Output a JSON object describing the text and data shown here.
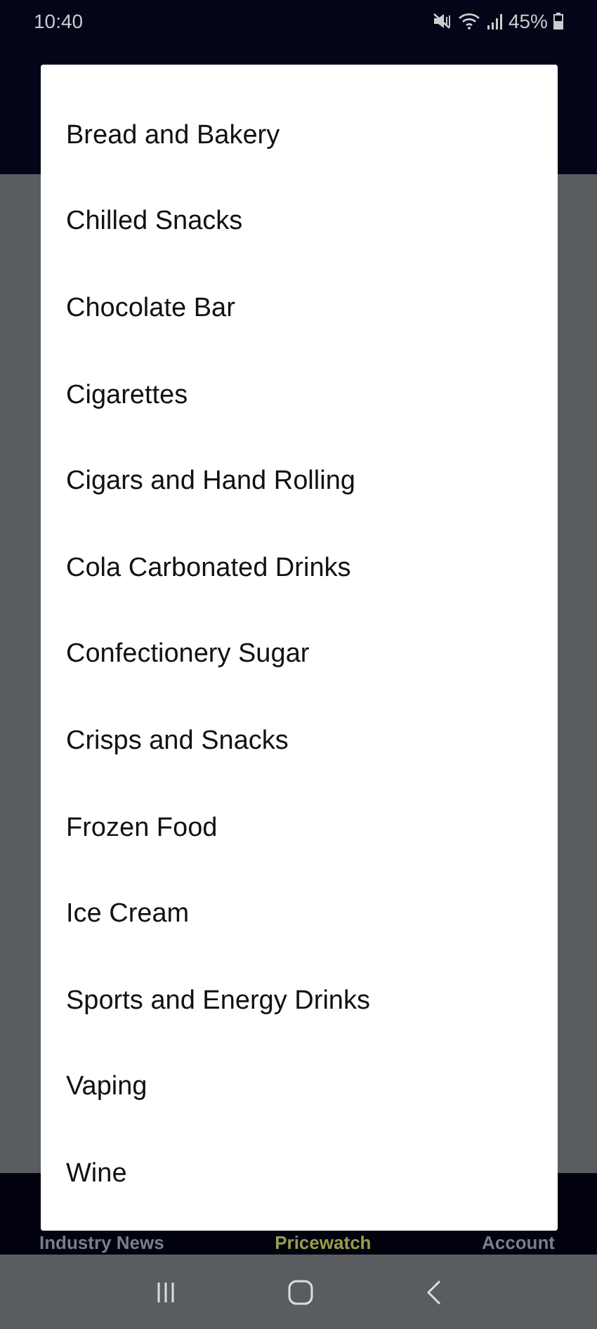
{
  "status_bar": {
    "time": "10:40",
    "battery": "45%"
  },
  "dialog": {
    "items": [
      {
        "label": "Bread and Bakery"
      },
      {
        "label": "Chilled Snacks"
      },
      {
        "label": "Chocolate Bar"
      },
      {
        "label": "Cigarettes"
      },
      {
        "label": "Cigars and Hand Rolling"
      },
      {
        "label": "Cola Carbonated Drinks"
      },
      {
        "label": "Confectionery Sugar"
      },
      {
        "label": "Crisps and Snacks"
      },
      {
        "label": "Frozen Food"
      },
      {
        "label": "Ice Cream"
      },
      {
        "label": "Sports and Energy Drinks"
      },
      {
        "label": "Vaping"
      },
      {
        "label": "Wine"
      }
    ]
  },
  "bottom_nav": [
    {
      "label": "Industry News",
      "selected": false
    },
    {
      "label": "Pricewatch",
      "selected": true
    },
    {
      "label": "Account",
      "selected": false
    }
  ]
}
